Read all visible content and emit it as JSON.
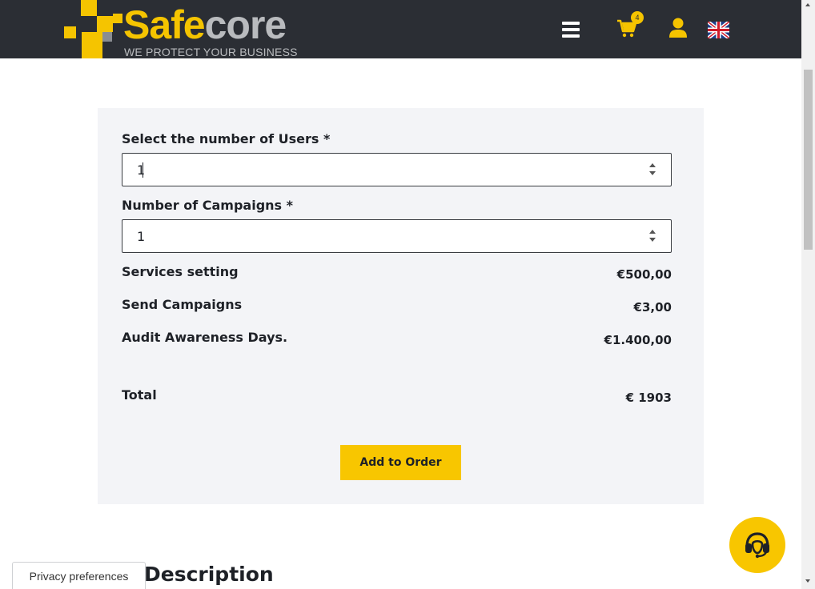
{
  "header": {
    "logo_text_a": "Safe",
    "logo_text_b": "core",
    "logo_tagline": "WE PROTECT YOUR BUSINESS",
    "cart_count": "4",
    "menu_icon": "hamburger-menu-icon",
    "cart_icon": "shopping-cart-icon",
    "user_icon": "user-icon",
    "language_icon": "uk-flag-icon"
  },
  "form": {
    "users_label": "Select the number of Users *",
    "users_value": "1",
    "campaigns_label": "Number of Campaigns *",
    "campaigns_value": "1"
  },
  "pricing": {
    "rows": [
      {
        "label": "Services setting",
        "price": "€500,00"
      },
      {
        "label": "Send Campaigns",
        "price": "€3,00"
      },
      {
        "label": "Audit Awareness Days.",
        "price": "€1.400,00"
      }
    ],
    "total_label": "Total",
    "total_value": "€ 1903"
  },
  "add_button_label": "Add to Order",
  "description_heading": "Description",
  "privacy_label": "Privacy preferences",
  "support_icon": "headset-support-icon",
  "colors": {
    "header_bg": "#2b2e34",
    "accent": "#f8c600",
    "card_bg": "#f3f4f7",
    "text": "#1e2127"
  }
}
